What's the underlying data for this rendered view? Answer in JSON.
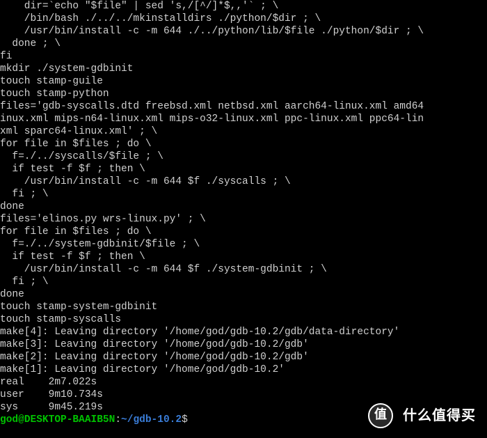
{
  "terminal": {
    "lines": [
      "    dir=`echo \"$file\" | sed 's,/[^/]*$,,'` ; \\",
      "    /bin/bash ./../../mkinstalldirs ./python/$dir ; \\",
      "    /usr/bin/install -c -m 644 ./../python/lib/$file ./python/$dir ; \\",
      "  done ; \\",
      "fi",
      "mkdir ./system-gdbinit",
      "touch stamp-guile",
      "touch stamp-python",
      "files='gdb-syscalls.dtd freebsd.xml netbsd.xml aarch64-linux.xml amd64",
      "inux.xml mips-n64-linux.xml mips-o32-linux.xml ppc-linux.xml ppc64-lin",
      "xml sparc64-linux.xml' ; \\",
      "for file in $files ; do \\",
      "  f=./../syscalls/$file ; \\",
      "  if test -f $f ; then \\",
      "    /usr/bin/install -c -m 644 $f ./syscalls ; \\",
      "  fi ; \\",
      "done",
      "files='elinos.py wrs-linux.py' ; \\",
      "for file in $files ; do \\",
      "  f=./../system-gdbinit/$file ; \\",
      "  if test -f $f ; then \\",
      "    /usr/bin/install -c -m 644 $f ./system-gdbinit ; \\",
      "  fi ; \\",
      "done",
      "touch stamp-system-gdbinit",
      "touch stamp-syscalls",
      "make[4]: Leaving directory '/home/god/gdb-10.2/gdb/data-directory'",
      "make[3]: Leaving directory '/home/god/gdb-10.2/gdb'",
      "make[2]: Leaving directory '/home/god/gdb-10.2/gdb'",
      "make[1]: Leaving directory '/home/god/gdb-10.2'",
      "",
      "real    2m7.022s",
      "user    9m10.734s",
      "sys     9m45.219s"
    ],
    "prompt": {
      "user": "god",
      "at": "@",
      "host": "DESKTOP-BAAIB5N",
      "colon": ":",
      "path": "~/gdb-10.2",
      "dollar": "$"
    }
  },
  "watermark": {
    "icon_char": "值",
    "text": "什么值得买"
  }
}
